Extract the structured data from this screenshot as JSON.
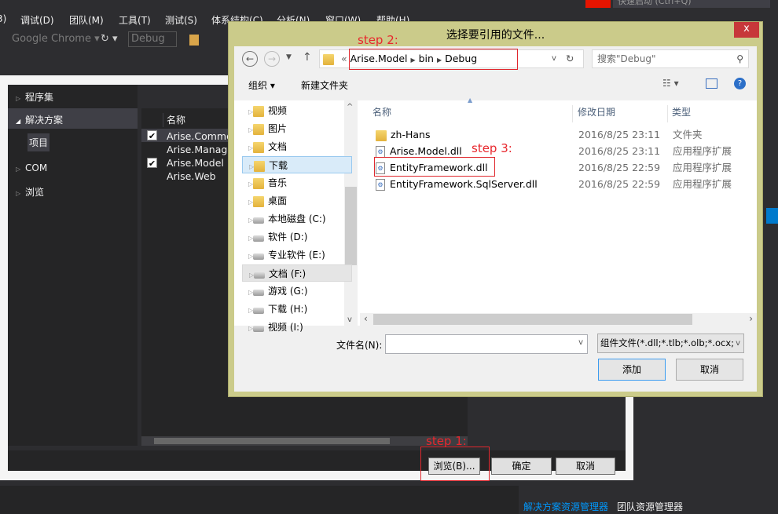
{
  "vs": {
    "menu": [
      "调试(D)",
      "团队(M)",
      "工具(T)",
      "测试(S)",
      "体系结构(C)",
      "分析(N)",
      "窗口(W)",
      "帮助(H)"
    ],
    "quick_launch": "快速启动 (Ctrl+Q)",
    "toolbar": {
      "browser": "Google Chrome",
      "config": "Debug"
    },
    "bottom_tabs": [
      "解决方案资源管理器",
      "团队资源管理器"
    ]
  },
  "ref_manager": {
    "left_items": [
      {
        "label": "程序集",
        "expanded": false
      },
      {
        "label": "解决方案",
        "expanded": true
      },
      {
        "label": "项目",
        "selected": true
      },
      {
        "label": "COM",
        "expanded": false
      },
      {
        "label": "浏览",
        "expanded": false
      }
    ],
    "column_name": "名称",
    "projects": [
      {
        "name": "Arise.Common",
        "checked": true
      },
      {
        "name": "Arise.Manage",
        "checked": false
      },
      {
        "name": "Arise.Model",
        "checked": true
      },
      {
        "name": "Arise.Web",
        "checked": false
      }
    ],
    "buttons": {
      "browse": "浏览(B)...",
      "ok": "确定",
      "cancel": "取消"
    },
    "step1": "step 1:"
  },
  "file_dialog": {
    "title": "选择要引用的文件...",
    "close": "x",
    "breadcrumb": [
      "Arise.Model",
      "bin",
      "Debug"
    ],
    "breadcrumb_prefix": "«",
    "search_placeholder": "搜索\"Debug\"",
    "organize": "组织 ▾",
    "new_folder": "新建文件夹",
    "nav": [
      {
        "label": "视频",
        "type": "folder"
      },
      {
        "label": "图片",
        "type": "folder"
      },
      {
        "label": "文档",
        "type": "folder"
      },
      {
        "label": "下载",
        "type": "folder",
        "selected": true
      },
      {
        "label": "音乐",
        "type": "folder"
      },
      {
        "label": "桌面",
        "type": "folder"
      },
      {
        "label": "本地磁盘 (C:)",
        "type": "drive"
      },
      {
        "label": "软件 (D:)",
        "type": "drive"
      },
      {
        "label": "专业软件 (E:)",
        "type": "drive"
      },
      {
        "label": "文档 (F:)",
        "type": "drive",
        "hover": true
      },
      {
        "label": "游戏 (G:)",
        "type": "drive"
      },
      {
        "label": "下载 (H:)",
        "type": "drive"
      },
      {
        "label": "视频 (I:)",
        "type": "drive"
      }
    ],
    "columns": {
      "name": "名称",
      "date": "修改日期",
      "type": "类型"
    },
    "files": [
      {
        "name": "zh-Hans",
        "date": "2016/8/25 23:11",
        "type": "文件夹",
        "kind": "folder"
      },
      {
        "name": "Arise.Model.dll",
        "date": "2016/8/25 23:11",
        "type": "应用程序扩展",
        "kind": "dll"
      },
      {
        "name": "EntityFramework.dll",
        "date": "2016/8/25 22:59",
        "type": "应用程序扩展",
        "kind": "dll"
      },
      {
        "name": "EntityFramework.SqlServer.dll",
        "date": "2016/8/25 22:59",
        "type": "应用程序扩展",
        "kind": "dll"
      }
    ],
    "filename_label": "文件名(N):",
    "filename_value": "",
    "filter": "组件文件(*.dll;*.tlb;*.olb;*.ocx;",
    "add": "添加",
    "cancel": "取消",
    "step2": "step 2:",
    "step3": "step 3:"
  },
  "colors": {
    "accent": "#007acc",
    "annotation": "#e0282e",
    "dialog_border": "#cbcb8a"
  }
}
